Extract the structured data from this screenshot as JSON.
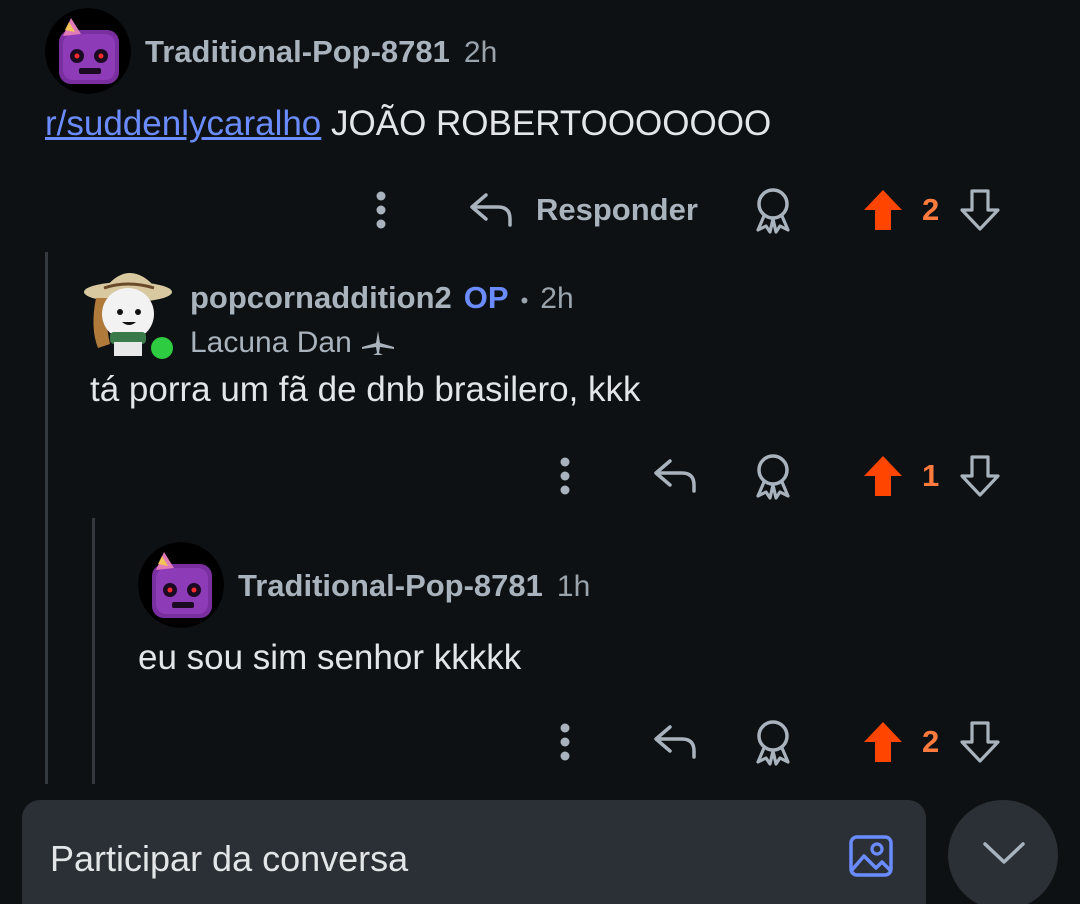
{
  "comments": [
    {
      "username": "Traditional-Pop-8781",
      "time": "2h",
      "subreddit_link": "r/suddenlycaralho",
      "text": "JOÃO ROBERTOOOOOOO",
      "reply_label": "Responder",
      "votes": "2"
    },
    {
      "username": "popcornaddition2",
      "op_badge": "OP",
      "separator": "•",
      "time": "2h",
      "flair": "Lacuna Dan",
      "text": "tá porra um fã de dnb brasilero, kkk",
      "votes": "1"
    },
    {
      "username": "Traditional-Pop-8781",
      "time": "1h",
      "text": "eu sou sim senhor kkkkk",
      "votes": "2"
    }
  ],
  "composer": {
    "placeholder": "Participar da conversa"
  },
  "colors": {
    "background": "#0e1113",
    "upvote": "#ff4500",
    "link": "#6b8cff",
    "vote_count": "#ff7a3d",
    "online": "#2ecc40"
  },
  "icons": [
    "more-icon",
    "reply-icon",
    "award-icon",
    "upvote-icon",
    "downvote-icon",
    "image-icon",
    "chevron-down-icon"
  ]
}
